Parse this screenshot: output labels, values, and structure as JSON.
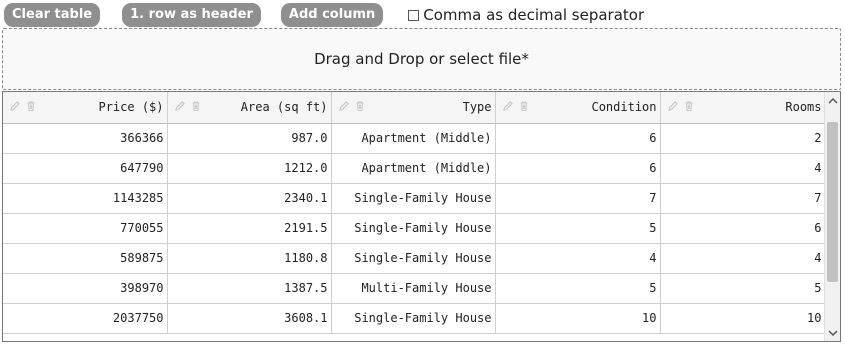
{
  "toolbar": {
    "clear_label": "Clear table",
    "header_label": "1. row as header",
    "add_column_label": "Add column",
    "comma_label": "Comma as decimal separator",
    "comma_checked": false
  },
  "dropzone": {
    "label": "Drag and Drop or select file*"
  },
  "table": {
    "columns": [
      {
        "label": "Price ($)",
        "header_icons": [
          "pencil-icon",
          "trash-icon"
        ]
      },
      {
        "label": "Area (sq ft)",
        "header_icons": [
          "pencil-icon",
          "trash-icon"
        ]
      },
      {
        "label": "Type",
        "header_icons": [
          "pencil-icon",
          "trash-icon"
        ]
      },
      {
        "label": "Condition",
        "header_icons": [
          "pencil-icon",
          "trash-icon"
        ]
      },
      {
        "label": "Rooms",
        "header_icons": [
          "pencil-icon",
          "trash-icon"
        ]
      }
    ],
    "rows": [
      [
        "366366",
        "987.0",
        "Apartment (Middle)",
        "6",
        "2"
      ],
      [
        "647790",
        "1212.0",
        "Apartment (Middle)",
        "6",
        "4"
      ],
      [
        "1143285",
        "2340.1",
        "Single-Family House",
        "7",
        "7"
      ],
      [
        "770055",
        "2191.5",
        "Single-Family House",
        "5",
        "6"
      ],
      [
        "589875",
        "1180.8",
        "Single-Family House",
        "4",
        "4"
      ],
      [
        "398970",
        "1387.5",
        "Multi-Family House",
        "5",
        "5"
      ],
      [
        "2037750",
        "3608.1",
        "Single-Family House",
        "10",
        "10"
      ]
    ]
  },
  "colors": {
    "button_bg": "#8f8f8f",
    "icon": "#c8c8c8",
    "grid": "#cfcfcf"
  }
}
